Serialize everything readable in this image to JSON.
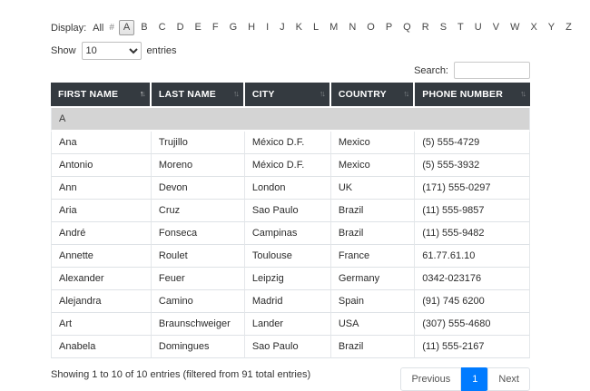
{
  "display_filter": {
    "label": "Display:",
    "all_label": "All",
    "hash_label": "#",
    "letters": [
      "A",
      "B",
      "C",
      "D",
      "E",
      "F",
      "G",
      "H",
      "I",
      "J",
      "K",
      "L",
      "M",
      "N",
      "O",
      "P",
      "Q",
      "R",
      "S",
      "T",
      "U",
      "V",
      "W",
      "X",
      "Y",
      "Z"
    ],
    "active_letter": "A"
  },
  "length_menu": {
    "show_label": "Show",
    "selected_value": "10",
    "entries_label": "entries"
  },
  "search": {
    "label": "Search:",
    "value": ""
  },
  "table": {
    "columns": [
      {
        "label": "FIRST NAME",
        "sorted": "asc"
      },
      {
        "label": "LAST NAME",
        "sorted": "none"
      },
      {
        "label": "CITY",
        "sorted": "none"
      },
      {
        "label": "COUNTRY",
        "sorted": "none"
      },
      {
        "label": "PHONE NUMBER",
        "sorted": "none"
      }
    ],
    "group_header": "A",
    "rows": [
      [
        "Ana",
        "Trujillo",
        "México D.F.",
        "Mexico",
        "(5) 555-4729"
      ],
      [
        "Antonio",
        "Moreno",
        "México D.F.",
        "Mexico",
        "(5) 555-3932"
      ],
      [
        "Ann",
        "Devon",
        "London",
        "UK",
        "(171) 555-0297"
      ],
      [
        "Aria",
        "Cruz",
        "Sao Paulo",
        "Brazil",
        "(11) 555-9857"
      ],
      [
        "André",
        "Fonseca",
        "Campinas",
        "Brazil",
        "(11) 555-9482"
      ],
      [
        "Annette",
        "Roulet",
        "Toulouse",
        "France",
        "61.77.61.10"
      ],
      [
        "Alexander",
        "Feuer",
        "Leipzig",
        "Germany",
        "0342-023176"
      ],
      [
        "Alejandra",
        "Camino",
        "Madrid",
        "Spain",
        "(91) 745 6200"
      ],
      [
        "Art",
        "Braunschweiger",
        "Lander",
        "USA",
        "(307) 555-4680"
      ],
      [
        "Anabela",
        "Domingues",
        "Sao Paulo",
        "Brazil",
        "(11) 555-2167"
      ]
    ]
  },
  "summary": {
    "info_text": "Showing 1 to 10 of 10 entries (filtered from 91 total entries)"
  },
  "pagination": {
    "previous_label": "Previous",
    "pages": [
      "1"
    ],
    "active_page": "1",
    "next_label": "Next"
  },
  "icons": {
    "sort_up": "↑",
    "sort_down": "↓",
    "select_caret": "▾"
  },
  "colors": {
    "header_bg": "#343a40",
    "active_page_bg": "#007bff",
    "group_row_bg": "#d4d4d4"
  }
}
